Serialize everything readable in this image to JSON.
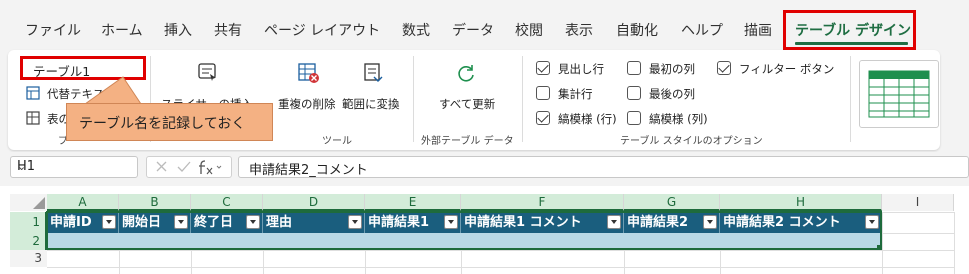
{
  "ribbon_tabs": [
    "ファイル",
    "ホーム",
    "挿入",
    "共有",
    "ページ レイアウト",
    "数式",
    "データ",
    "校閲",
    "表示",
    "自動化",
    "ヘルプ",
    "描画",
    "テーブル デザイン"
  ],
  "active_tab": "テーブル デザイン",
  "properties": {
    "table_name": "テーブル1",
    "alt_text_label": "代替テキス",
    "table_size_label": "表の",
    "group_label": "プ"
  },
  "callout_text": "テーブル名を記録しておく",
  "tools": {
    "slicer_label": "スライサーの挿入",
    "remove_duplicates": "重複の削除",
    "convert_to_range": "範囲に変換",
    "group_label": "ツール"
  },
  "external_data": {
    "refresh_all": "すべて更新",
    "group_label": "外部テーブル データ"
  },
  "style_options": {
    "header_row": {
      "label": "見出し行",
      "checked": true
    },
    "total_row": {
      "label": "集計行",
      "checked": false
    },
    "banded_rows": {
      "label": "縞模様 (行)",
      "checked": true
    },
    "first_column": {
      "label": "最初の列",
      "checked": false
    },
    "last_column": {
      "label": "最後の列",
      "checked": false
    },
    "banded_columns": {
      "label": "縞模様 (列)",
      "checked": false
    },
    "filter_button": {
      "label": "フィルター ボタン",
      "checked": true
    },
    "group_label": "テーブル スタイルのオプション"
  },
  "formula_bar": {
    "cell_ref": "H1",
    "dropdown": "⌄",
    "content": "申請結果2_コメント"
  },
  "columns": [
    "A",
    "B",
    "C",
    "D",
    "E",
    "F",
    "G",
    "H",
    "I"
  ],
  "rows": [
    "1",
    "2",
    "3"
  ],
  "table_headers": [
    "申請ID",
    "開始日",
    "終了日",
    "理由",
    "申請結果1",
    "申請結果1 コメント",
    "申請結果2",
    "申請結果2 コメント"
  ],
  "colors": {
    "header_fill": "#1a5e7e",
    "band_fill": "#b9d9e6",
    "accent": "#1f6e43",
    "highlight_red": "#e00000",
    "callout_fill": "#f4b183"
  }
}
